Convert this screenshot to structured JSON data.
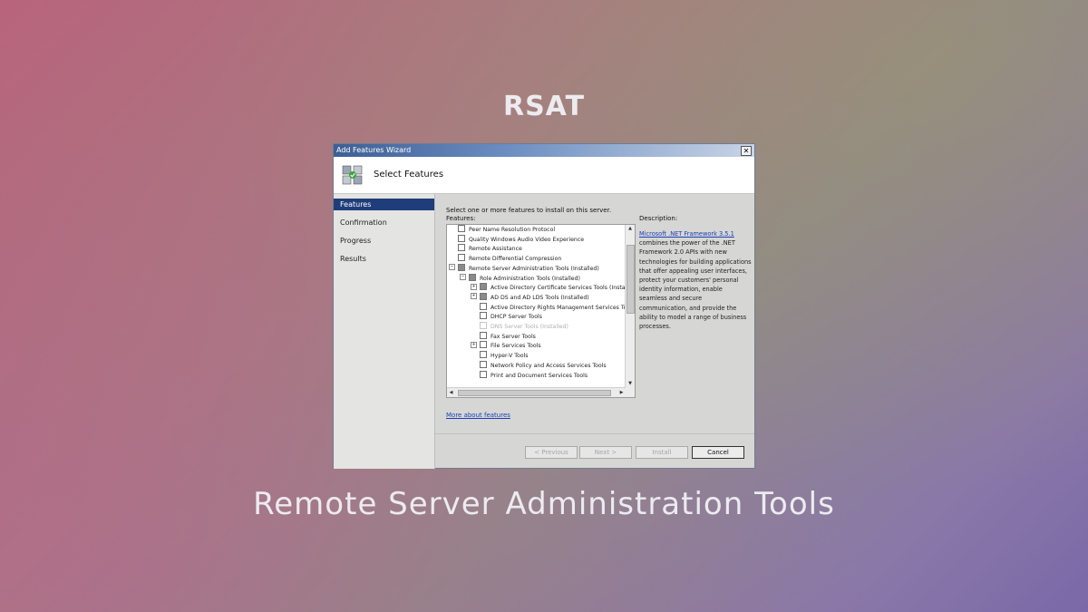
{
  "overlay": {
    "top_text": "RSAT",
    "bottom_text": "Remote Server Administration Tools"
  },
  "window": {
    "title": "Add Features Wizard",
    "close_glyph": "✕",
    "header_title": "Select Features",
    "header_icon": "features-wizard-icon"
  },
  "nav": {
    "items": [
      {
        "label": "Features",
        "active": true
      },
      {
        "label": "Confirmation",
        "active": false
      },
      {
        "label": "Progress",
        "active": false
      },
      {
        "label": "Results",
        "active": false
      }
    ]
  },
  "content": {
    "prompt": "Select one or more features to install on this server.",
    "features_label": "Features:",
    "description_label": "Description:",
    "tree": [
      {
        "label": "Peer Name Resolution Protocol",
        "level": 0,
        "expander": "",
        "state": "unchecked"
      },
      {
        "label": "Quality Windows Audio Video Experience",
        "level": 0,
        "expander": "",
        "state": "unchecked"
      },
      {
        "label": "Remote Assistance",
        "level": 0,
        "expander": "",
        "state": "unchecked"
      },
      {
        "label": "Remote Differential Compression",
        "level": 0,
        "expander": "",
        "state": "unchecked"
      },
      {
        "label": "Remote Server Administration Tools  (Installed)",
        "level": 0,
        "expander": "−",
        "state": "partial"
      },
      {
        "label": "Role Administration Tools  (Installed)",
        "level": 1,
        "expander": "−",
        "state": "partial"
      },
      {
        "label": "Active Directory Certificate Services Tools  (Installed)",
        "level": 2,
        "expander": "+",
        "state": "partial"
      },
      {
        "label": "AD DS and AD LDS Tools  (Installed)",
        "level": 2,
        "expander": "+",
        "state": "partial"
      },
      {
        "label": "Active Directory Rights Management Services Tools",
        "level": 2,
        "expander": "",
        "state": "unchecked"
      },
      {
        "label": "DHCP Server Tools",
        "level": 2,
        "expander": "",
        "state": "unchecked"
      },
      {
        "label": "DNS Server Tools  (Installed)",
        "level": 2,
        "expander": "",
        "state": "disabled"
      },
      {
        "label": "Fax Server Tools",
        "level": 2,
        "expander": "",
        "state": "unchecked"
      },
      {
        "label": "File Services Tools",
        "level": 2,
        "expander": "+",
        "state": "unchecked"
      },
      {
        "label": "Hyper-V Tools",
        "level": 2,
        "expander": "",
        "state": "unchecked"
      },
      {
        "label": "Network Policy and Access Services Tools",
        "level": 2,
        "expander": "",
        "state": "unchecked"
      },
      {
        "label": "Print and Document Services Tools",
        "level": 2,
        "expander": "",
        "state": "unchecked"
      }
    ],
    "scroll": {
      "up": "▲",
      "down": "▼",
      "left": "◀",
      "right": "▶"
    },
    "description_link": "Microsoft .NET Framework 3.5.1",
    "description_body": " combines the power of the .NET Framework 2.0 APIs with new technologies for building applications that offer appealing user interfaces, protect your customers' personal identity information, enable seamless and secure communication, and provide the ability to model a range of business processes.",
    "more_link": "More about features"
  },
  "buttons": {
    "previous": "< Previous",
    "next": "Next >",
    "install": "Install",
    "cancel": "Cancel"
  },
  "colors": {
    "nav_active": "#1f3d7a",
    "link": "#1a3fb8",
    "title_bar": "#3d5f95"
  }
}
